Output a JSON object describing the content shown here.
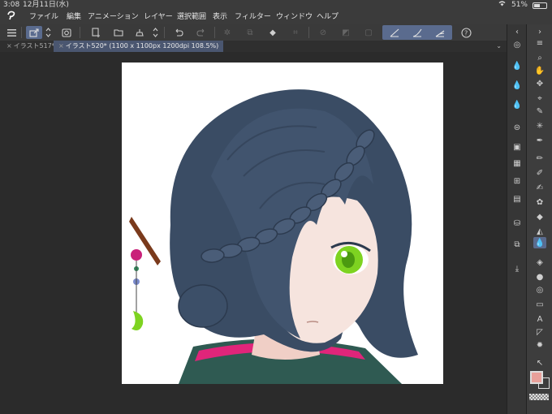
{
  "status": {
    "time": "3:08",
    "date": "12月11日(水)",
    "battery": "51%",
    "battery_level": 0.51
  },
  "menu": {
    "items": [
      "ファイル",
      "編集",
      "アニメーション",
      "レイヤー",
      "選択範囲",
      "表示",
      "フィルター",
      "ウィンドウ",
      "ヘルプ"
    ]
  },
  "tabs": [
    {
      "label": "イラスト517*"
    },
    {
      "label": "イラスト520* (1100 x 1100px 1200dpi 108.5%)"
    }
  ],
  "colors": {
    "accent": "#5a6b8e",
    "main_color": "#e8a09a",
    "canvas": "#ffffff",
    "hair": "#3d5068",
    "eye": "#7ed321"
  },
  "icons": {
    "toolbar": [
      "menu-icon",
      "layer-move-icon",
      "spinner-icon",
      "camera-icon",
      "new-canvas-icon",
      "open-folder-icon",
      "save-icon",
      "spinner-icon",
      "undo-icon",
      "redo-icon",
      "transform-icon",
      "select-all-icon",
      "fill-icon",
      "crop-icon",
      "deselect-icon",
      "invert-icon",
      "select-icon",
      "ruler-icon",
      "curve-ruler-icon",
      "perspective-ruler-icon",
      "help-icon"
    ],
    "tool_strip": [
      "zoom-icon",
      "hand-icon",
      "move-icon",
      "select-layer-icon",
      "eyedropper-icon",
      "wand-icon",
      "pen-icon",
      "pencil-icon",
      "brush-icon",
      "airbrush-icon",
      "decoration-icon",
      "eraser-icon",
      "blend-icon",
      "fill-icon",
      "gradient-icon",
      "figure-icon",
      "frame-icon",
      "text-icon",
      "balloon-icon",
      "line-icon",
      "object-icon"
    ]
  }
}
